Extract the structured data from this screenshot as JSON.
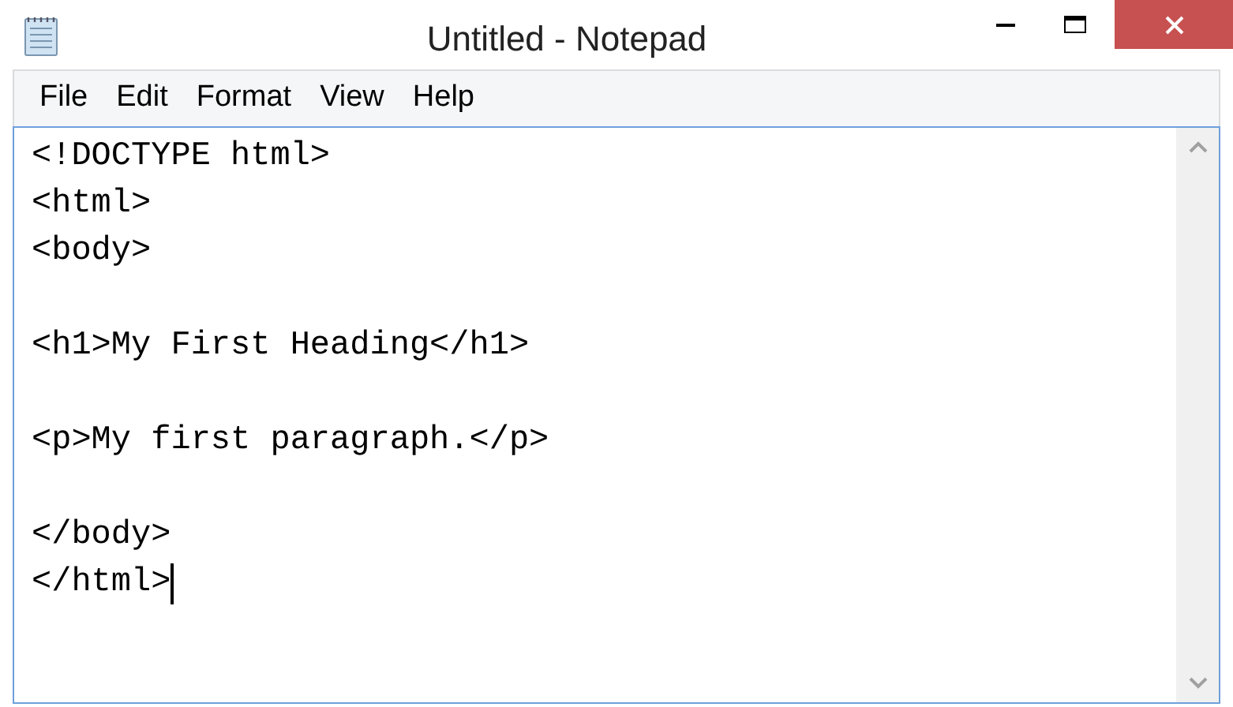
{
  "window": {
    "title": "Untitled - Notepad"
  },
  "menu": [
    {
      "label": "File"
    },
    {
      "label": "Edit"
    },
    {
      "label": "Format"
    },
    {
      "label": "View"
    },
    {
      "label": "Help"
    }
  ],
  "editor": {
    "text": "<!DOCTYPE html>\n<html>\n<body>\n\n<h1>My First Heading</h1>\n\n<p>My first paragraph.</p>\n\n</body>\n</html>"
  }
}
